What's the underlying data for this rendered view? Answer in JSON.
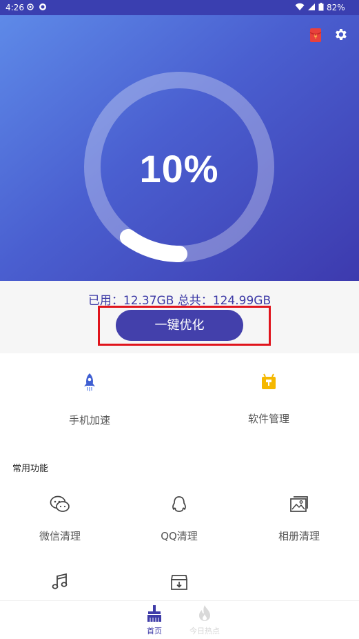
{
  "status_bar": {
    "time": "4:26",
    "battery": "82%"
  },
  "hero": {
    "percent": "10%",
    "usage_fraction": 0.1
  },
  "storage": {
    "text": "已用：12.37GB 总共：124.99GB",
    "button_label": "一键优化"
  },
  "tools": {
    "speed_label": "手机加速",
    "software_label": "软件管理"
  },
  "section": {
    "title": "常用功能"
  },
  "functions": {
    "wechat_label": "微信清理",
    "qq_label": "QQ清理",
    "album_label": "相册清理"
  },
  "bottom_nav": {
    "home_label": "首页",
    "hot_label": "今日热点"
  },
  "colors": {
    "accent": "#4340ab",
    "highlight": "#e0141c",
    "software_icon": "#f5b800"
  }
}
